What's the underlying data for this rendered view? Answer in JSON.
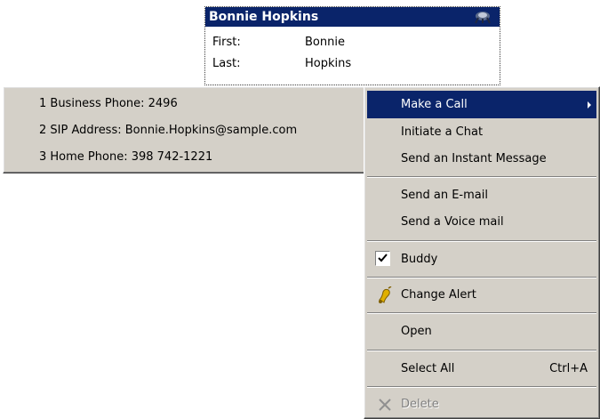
{
  "contact_card": {
    "name": "Bonnie Hopkins",
    "fields": [
      {
        "label": "First:",
        "value": "Bonnie"
      },
      {
        "label": "Last:",
        "value": "Hopkins"
      }
    ],
    "icon": "user-presence-icon"
  },
  "submenu": {
    "items": [
      {
        "label": "1 Business Phone: 2496"
      },
      {
        "label": "2 SIP Address: Bonnie.Hopkins@sample.com"
      },
      {
        "label": "3 Home Phone: 398 742-1221"
      }
    ]
  },
  "context_menu": {
    "items": [
      {
        "label": "Make a Call",
        "highlighted": true,
        "has_submenu": true
      },
      {
        "label": "Initiate a Chat"
      },
      {
        "label": "Send an Instant Message"
      },
      {
        "label": "Send an E-mail"
      },
      {
        "label": "Send a Voice mail"
      },
      {
        "label": "Buddy",
        "checked": true,
        "icon": "checkmark-icon"
      },
      {
        "label": "Change Alert",
        "icon": "bell-icon"
      },
      {
        "label": "Open"
      },
      {
        "label": "Select All",
        "shortcut": "Ctrl+A"
      },
      {
        "label": "Delete",
        "disabled": true,
        "icon": "delete-x-icon"
      }
    ]
  },
  "colors": {
    "highlight": "#0a246a",
    "menu_bg": "#d4d0c8",
    "alert_icon": "#e0b000"
  }
}
